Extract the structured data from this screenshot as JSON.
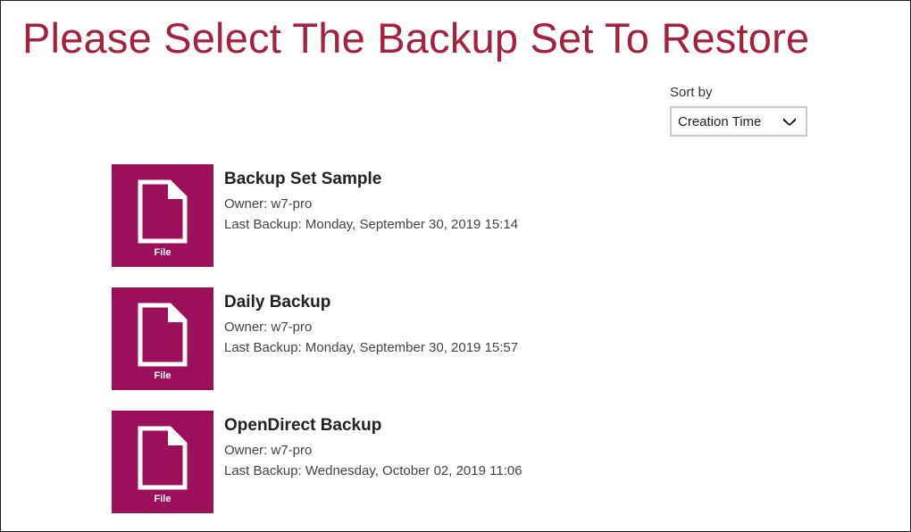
{
  "page": {
    "title": "Please Select The Backup Set To Restore"
  },
  "sort": {
    "label": "Sort by",
    "selected": "Creation Time",
    "icon": "chevron-down-icon"
  },
  "colors": {
    "title": "#a3223d",
    "tile": "#9c0f5a"
  },
  "backup_sets": [
    {
      "name": "Backup Set Sample",
      "type_label": "File",
      "icon": "file-icon",
      "owner": "Owner: w7-pro",
      "last_backup": "Last Backup: Monday, September 30, 2019 15:14"
    },
    {
      "name": "Daily Backup",
      "type_label": "File",
      "icon": "file-icon",
      "owner": "Owner: w7-pro",
      "last_backup": "Last Backup: Monday, September 30, 2019 15:57"
    },
    {
      "name": "OpenDirect Backup",
      "type_label": "File",
      "icon": "file-icon",
      "owner": "Owner: w7-pro",
      "last_backup": "Last Backup: Wednesday, October 02, 2019 11:06"
    }
  ]
}
